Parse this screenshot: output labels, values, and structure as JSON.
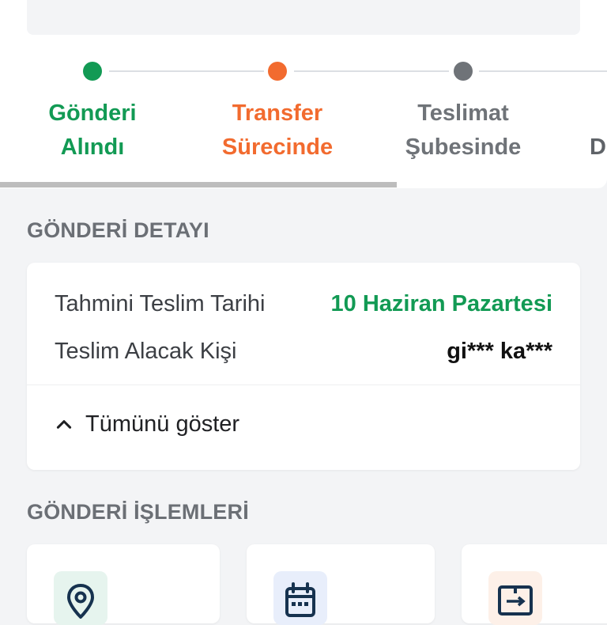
{
  "tracker": {
    "steps": [
      {
        "label": "Gönderi\nAlındı",
        "color": "#129a54"
      },
      {
        "label": "Transfer\nSürecinde",
        "color": "#f26b2f"
      },
      {
        "label": "Teslimat\nŞubesinde",
        "color": "#6f7378"
      },
      {
        "label": "\nD",
        "color": "#6f7378"
      }
    ]
  },
  "detail": {
    "title": "GÖNDERİ DETAYI",
    "rows": [
      {
        "label": "Tahmini Teslim Tarihi",
        "value": "10 Haziran Pazartesi",
        "value_color": "#129a54"
      },
      {
        "label": "Teslim Alacak Kişi",
        "value": "gi*** ka***",
        "value_color": "#111111"
      }
    ],
    "expand_label": "Tümünü göster",
    "expand_icon": "chevron-up-icon"
  },
  "actions": {
    "title": "GÖNDERİ İŞLEMLERİ",
    "items": [
      {
        "icon": "location-pin-icon",
        "icon_bg": "#e6f4ee"
      },
      {
        "icon": "calendar-icon",
        "icon_bg": "#e8eefb"
      },
      {
        "icon": "transfer-icon",
        "icon_bg": "#fdf0e8"
      }
    ]
  }
}
